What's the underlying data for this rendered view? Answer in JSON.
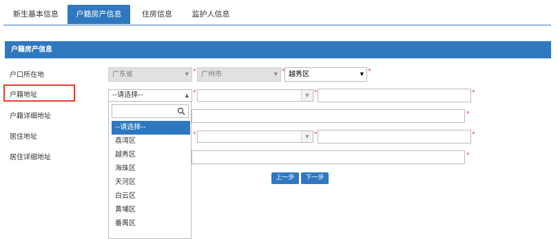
{
  "tabs": [
    {
      "label": "新生基本信息"
    },
    {
      "label": "户籍房产信息"
    },
    {
      "label": "住房信息"
    },
    {
      "label": "监护人信息"
    }
  ],
  "panel": {
    "title": "户籍房产信息",
    "rows": {
      "hukou_location": {
        "label": "户口所在地",
        "province": "广东省",
        "city": "广州市",
        "district": "越秀区"
      },
      "hukou_address": {
        "label": "户籍地址",
        "select_value": "--请选择--"
      },
      "hukou_detail": {
        "label": "户籍详细地址"
      },
      "residence_address": {
        "label": "居住地址"
      },
      "residence_detail": {
        "label": "居住详细地址"
      }
    },
    "required_mark": "*"
  },
  "dropdown": {
    "search_value": "",
    "options": [
      "--请选择--",
      "荔湾区",
      "越秀区",
      "海珠区",
      "天河区",
      "白云区",
      "黄埔区",
      "番禺区"
    ],
    "selected": "--请选择--"
  },
  "buttons": {
    "prev": "上一步",
    "next": "下一步"
  },
  "colors": {
    "accent": "#2f78c0",
    "highlight": "#e53935",
    "required": "#ee3333"
  }
}
